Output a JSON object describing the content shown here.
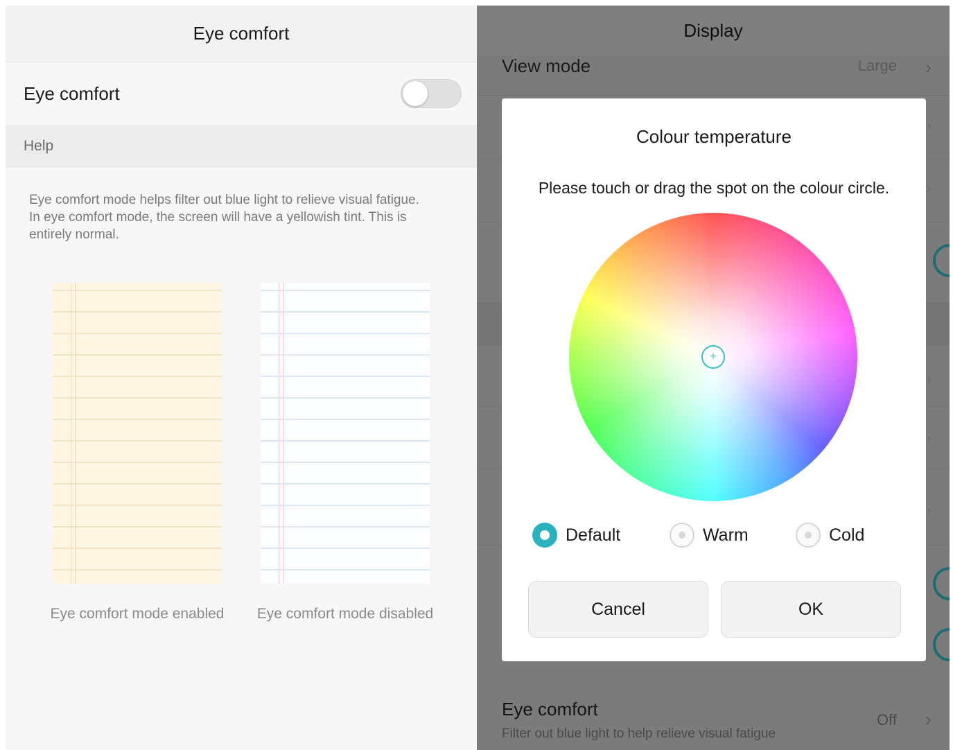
{
  "left": {
    "header_title": "Eye comfort",
    "toggle_label": "Eye comfort",
    "toggle_on": false,
    "help_label": "Help",
    "help_line1": "Eye comfort mode helps filter out blue light to relieve visual fatigue.",
    "help_line2": "In eye comfort mode, the screen will have a yellowish tint. This is entirely normal.",
    "caption_enabled": "Eye comfort mode enabled",
    "caption_disabled": "Eye comfort mode disabled"
  },
  "right": {
    "header_title": "Display",
    "view_mode_label": "View mode",
    "view_mode_value": "Large",
    "eye_comfort_title": "Eye comfort",
    "eye_comfort_subtitle": "Filter out blue light to help relieve visual fatigue",
    "eye_comfort_value": "Off",
    "dialog": {
      "title": "Colour temperature",
      "instruction": "Please touch or drag the spot on the colour circle.",
      "options": [
        {
          "label": "Default",
          "selected": true
        },
        {
          "label": "Warm",
          "selected": false
        },
        {
          "label": "Cold",
          "selected": false
        }
      ],
      "cancel_label": "Cancel",
      "ok_label": "OK"
    }
  },
  "colors": {
    "accent": "#2ab3bd",
    "warm_paper": "#fdf6e3",
    "cool_paper": "#fbfdff",
    "overlay_background": "#7b7b7b"
  },
  "icons": {
    "spot": "crosshair-spot-icon",
    "chevron": "chevron-right-icon"
  }
}
